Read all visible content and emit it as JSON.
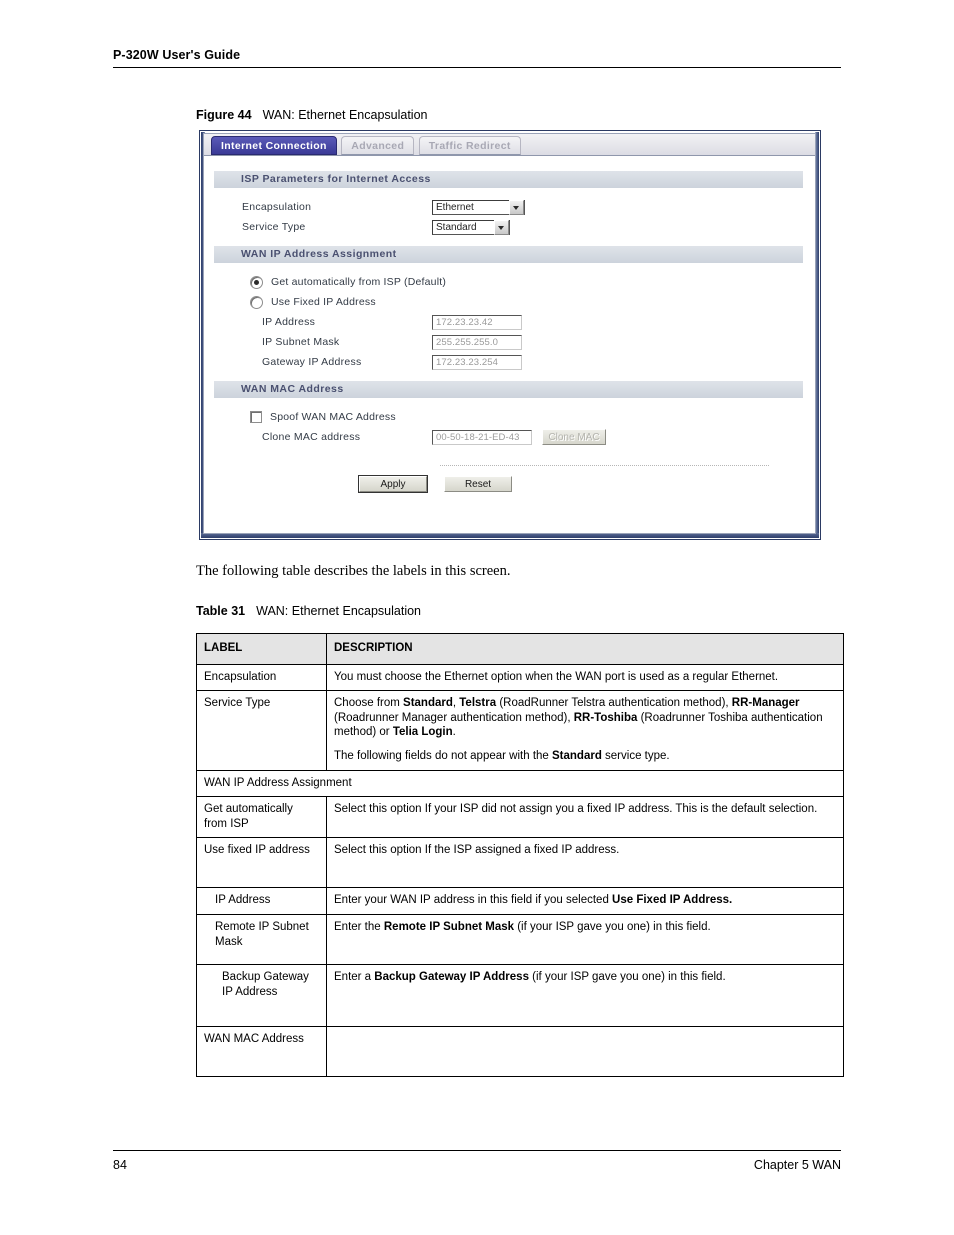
{
  "page_header": {
    "title": "P-320W User's Guide"
  },
  "figure": {
    "label": "Figure 44",
    "title": "WAN: Ethernet Encapsulation"
  },
  "screenshot": {
    "tabs": [
      {
        "label": "Internet Connection",
        "active": true
      },
      {
        "label": "Advanced",
        "active": false
      },
      {
        "label": "Traffic Redirect",
        "active": false
      }
    ],
    "sections": {
      "isp": {
        "heading": "ISP Parameters for Internet Access",
        "encapsulation_label": "Encapsulation",
        "encapsulation_value": "Ethernet",
        "service_type_label": "Service Type",
        "service_type_value": "Standard"
      },
      "wan_ip": {
        "heading": "WAN IP Address Assignment",
        "radio_auto_label": "Get automatically from ISP (Default)",
        "radio_fixed_label": "Use Fixed IP Address",
        "ip_address_label": "IP Address",
        "ip_address_value": "172.23.23.42",
        "subnet_mask_label": "IP Subnet Mask",
        "subnet_mask_value": "255.255.255.0",
        "gateway_label": "Gateway IP Address",
        "gateway_value": "172.23.23.254"
      },
      "wan_mac": {
        "heading": "WAN MAC Address",
        "spoof_label": "Spoof WAN MAC Address",
        "clone_label": "Clone MAC address",
        "clone_value": "00-50-18-21-ED-43",
        "clone_button": "Clone MAC"
      }
    },
    "buttons": {
      "apply": "Apply",
      "reset": "Reset"
    },
    "colors": {
      "active_tab": "#4646a8",
      "section_header_bg": "#d3d9e0",
      "panel_border": "#2b3a63"
    }
  },
  "paragraph": "The following table describes the labels in this screen.",
  "table_caption": {
    "label": "Table 31",
    "title": "WAN: Ethernet Encapsulation"
  },
  "table": {
    "headers": [
      "LABEL",
      "DESCRIPTION"
    ],
    "rows": [
      {
        "label": "Encapsulation",
        "desc_html": "You must choose the Ethernet option when the WAN port is used as a regular Ethernet."
      },
      {
        "label": "Service Type",
        "desc_html": "Choose from <b>Standard</b>, <b>Telstra</b> (RoadRunner Telstra authentication method), <b>RR-Manager</b> (Roadrunner Manager authentication method), <b>RR-Toshiba</b> (Roadrunner Toshiba authentication method) or <b>Telia Login</b>.",
        "desc_html_2": "The following fields do not appear with the <b>Standard</b> service type."
      },
      {
        "label": "WAN IP Address Assignment",
        "span": true
      },
      {
        "label": "Get automatically from ISP",
        "desc_html": "Select this option If your ISP did not assign you a fixed IP address. This is the default selection."
      },
      {
        "label": "Use fixed IP address",
        "desc_html": "Select this option If the ISP assigned a fixed IP address."
      },
      {
        "label": "IP Address",
        "indent": 1,
        "desc_html": "Enter your WAN IP address in this field if you selected <b>Use Fixed IP Address.</b>"
      },
      {
        "label": "Remote IP Subnet Mask",
        "indent": 1,
        "desc_html": "Enter the <b>Remote IP Subnet Mask</b> (if your ISP gave you one) in this field."
      },
      {
        "label": "Backup Gateway IP Address",
        "indent": 2,
        "desc_html": "Enter a <b>Backup Gateway IP Address</b> (if your ISP gave you one) in this field."
      },
      {
        "label": "WAN MAC Address",
        "desc_html": ""
      }
    ]
  },
  "footer": {
    "page_number": "84",
    "chapter": "Chapter 5 WAN"
  }
}
